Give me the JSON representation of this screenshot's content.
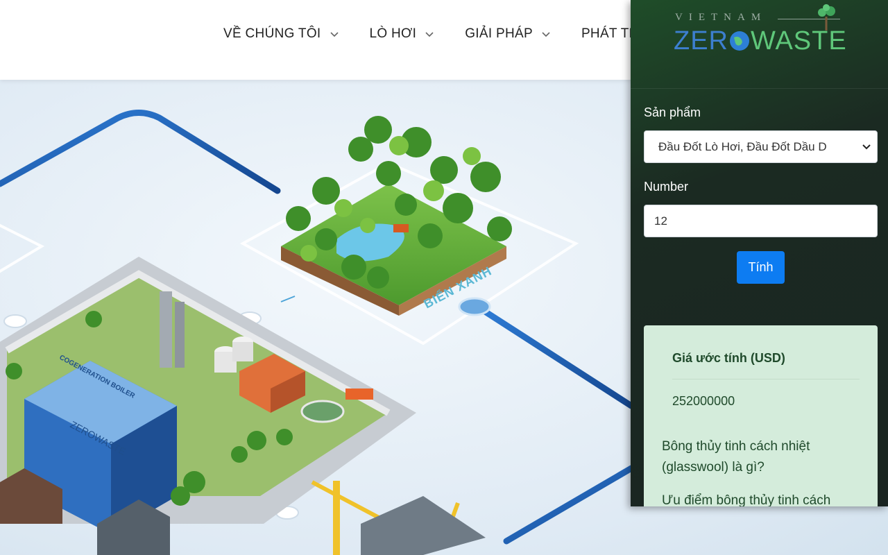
{
  "nav": {
    "items": [
      {
        "label": "VỀ CHÚNG TÔI"
      },
      {
        "label": "LÒ HƠI"
      },
      {
        "label": "GIẢI PHÁP"
      },
      {
        "label": "PHÁT TR"
      }
    ]
  },
  "hero": {
    "area_label": "BIỂN XANH",
    "building_label": "COGENERATION BOILER",
    "building_logo": "ZEROWASTE"
  },
  "panel": {
    "logo_top": "VIETNAM",
    "logo_main_left": "ZER",
    "logo_main_right": "WAS",
    "logo_main_end": "E",
    "product_label": "Sản phẩm",
    "product_selected": "Đầu Đốt Lò Hơi, Đầu Đốt Dầu D",
    "number_label": "Number",
    "number_value": "12",
    "calc_button": "Tính",
    "result_title": "Giá ước tính (USD)",
    "result_value": "252000000",
    "links": [
      "Bông thủy tinh cách nhiệt (glasswool) là gì?",
      "Ưu điểm bông thủy tinh cách"
    ]
  },
  "colors": {
    "accent_blue": "#0d7cf2",
    "panel_bg": "#1b2a22",
    "result_bg": "#d4ecdb",
    "pipe_blue": "#1d5fae",
    "label_teal": "#5bb8d4"
  }
}
